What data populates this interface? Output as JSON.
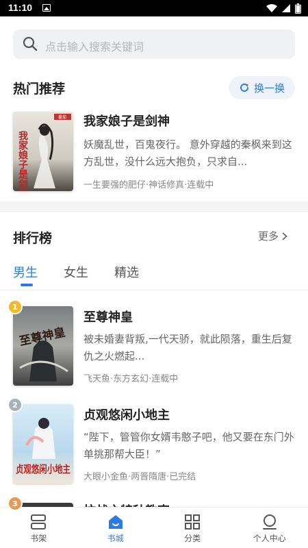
{
  "status_bar": {
    "time": "11:10"
  },
  "search": {
    "placeholder": "点击输入搜索关键词"
  },
  "hot": {
    "title": "热门推荐",
    "swap_label": "换一换",
    "book": {
      "title": "我家娘子是剑神",
      "desc": "妖魔乱世，百鬼夜行。 意外穿越的秦枫来到这方乱世，没什么远大抱负，只求自...",
      "meta": "一生要强的肥仔·神话修真·连载中",
      "cover_text": "我家娘子是剑神",
      "cover_tag": "番茄"
    }
  },
  "ranking": {
    "title": "排行榜",
    "more_label": "更多",
    "tabs": [
      "男生",
      "女生",
      "精选"
    ],
    "active_tab": 0,
    "books": [
      {
        "rank": "1",
        "title": "至尊神皇",
        "desc": "被未婚妻背叛,一代天骄，就此陨落，重生后复仇之火燃起...",
        "meta": "飞天鱼·东方玄幻·连载中",
        "cover_text": "至尊神皇"
      },
      {
        "rank": "2",
        "title": "贞观悠闲小地主",
        "desc": "“陛下，管管你女婿韦憨子吧，他又要在东门外单挑那帮大臣！”",
        "meta": "大眼小金鱼·两晋隋唐·已完结",
        "cover_text": "贞观悠闲小地主"
      },
      {
        "rank": "3",
        "title": "抗战之特种教官",
        "desc": "",
        "meta": "",
        "cover_text": ""
      }
    ]
  },
  "bottom_nav": [
    {
      "label": "书架",
      "icon": "bookshelf-icon"
    },
    {
      "label": "书城",
      "icon": "bookstore-icon"
    },
    {
      "label": "分类",
      "icon": "category-grid-icon"
    },
    {
      "label": "个人中心",
      "icon": "profile-icon"
    }
  ],
  "active_nav": 1,
  "colors": {
    "accent": "#2c7be5",
    "gold": "#f5b828",
    "silver": "#a7b1bd",
    "bronze": "#e79a55"
  }
}
